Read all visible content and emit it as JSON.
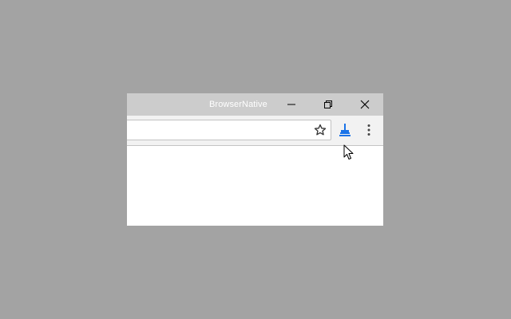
{
  "window": {
    "title": "BrowserNative"
  },
  "titlebar_buttons": {
    "minimize_icon": "minimize-icon",
    "restore_icon": "restore-icon",
    "close_icon": "close-icon"
  },
  "toolbar": {
    "address_value": "",
    "bookmark_icon": "star-icon",
    "extension_icon": "broom-icon",
    "menu_icon": "vertical-ellipsis-icon"
  },
  "colors": {
    "desktop": "#a3a3a3",
    "titlebar": "#cccccc",
    "toolbar": "#f2f2f2",
    "extension_accent": "#1a73e8"
  }
}
